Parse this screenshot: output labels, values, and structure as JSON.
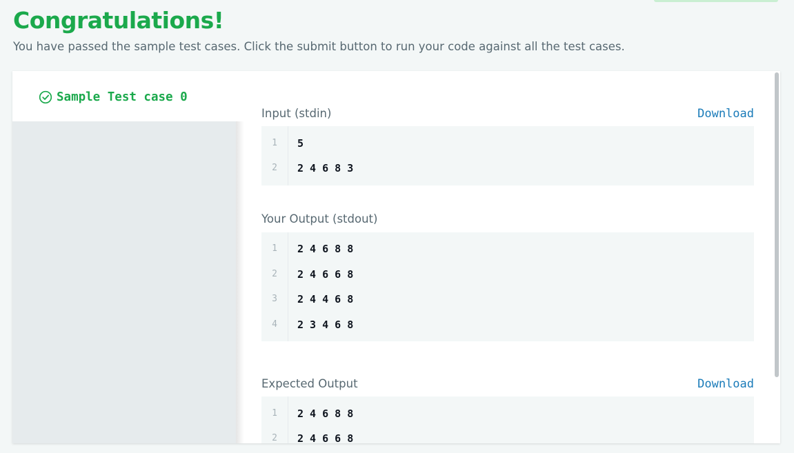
{
  "header": {
    "title": "Congratulations!",
    "subtitle": "You have passed the sample test cases. Click the submit button to run your code against all the test cases."
  },
  "tabs": [
    {
      "label": "Sample Test case 0",
      "status": "passed",
      "icon": "check-circle-icon",
      "active": true
    }
  ],
  "sections": {
    "input": {
      "label": "Input (stdin)",
      "download_label": "Download",
      "lines": [
        {
          "num": "1",
          "text": "5"
        },
        {
          "num": "2",
          "text": "2 4 6 8 3"
        }
      ]
    },
    "output": {
      "label": "Your Output (stdout)",
      "lines": [
        {
          "num": "1",
          "text": "2 4 6 8 8"
        },
        {
          "num": "2",
          "text": "2 4 6 6 8"
        },
        {
          "num": "3",
          "text": "2 4 4 6 8"
        },
        {
          "num": "4",
          "text": "2 3 4 6 8"
        }
      ]
    },
    "expected": {
      "label": "Expected Output",
      "download_label": "Download",
      "lines": [
        {
          "num": "1",
          "text": "2 4 6 8 8"
        },
        {
          "num": "2",
          "text": "2 4 6 6 8"
        }
      ]
    }
  },
  "colors": {
    "success": "#1ba94c",
    "link": "#1a7bb9",
    "muted_text": "#576871",
    "code_bg": "#f3f7f7"
  }
}
